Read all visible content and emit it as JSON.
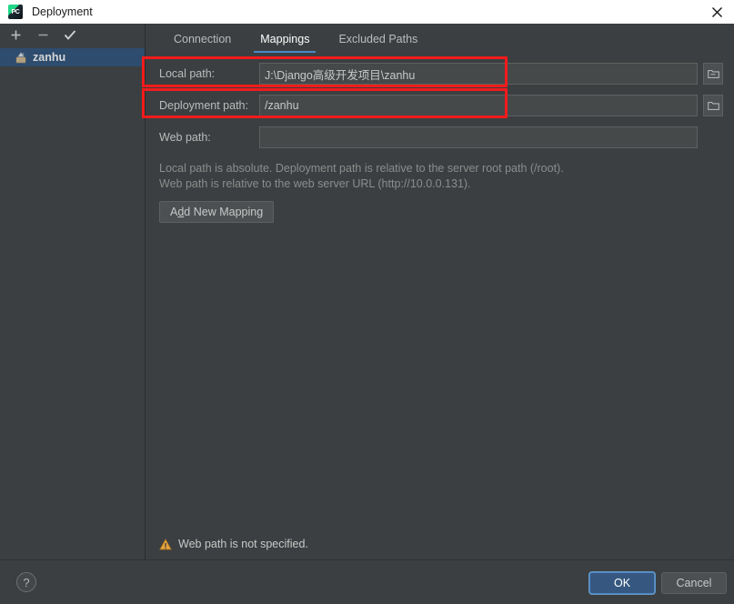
{
  "window": {
    "title": "Deployment",
    "app_icon": "pycharm-icon",
    "app_icon_text": "PC",
    "close_icon": "close-icon"
  },
  "sidebar": {
    "toolbar": [
      {
        "name": "add-server-button",
        "icon": "plus-icon",
        "label": "+"
      },
      {
        "name": "remove-server-button",
        "icon": "minus-icon",
        "label": "−"
      },
      {
        "name": "set-default-server-button",
        "icon": "check-icon",
        "label": "✓"
      }
    ],
    "items": [
      {
        "label": "zanhu",
        "icon": "remote-host-icon",
        "selected": true
      }
    ]
  },
  "main": {
    "tabs": [
      {
        "label": "Connection",
        "active": false
      },
      {
        "label": "Mappings",
        "active": true
      },
      {
        "label": "Excluded Paths",
        "active": false
      }
    ],
    "fields": [
      {
        "label": "Local path:",
        "value": "J:\\Django高级开发项目\\zanhu",
        "placeholder": "",
        "browse_icon": "folder-icon",
        "has_browse": true,
        "highlighted": true
      },
      {
        "label": "Deployment path:",
        "value": "/zanhu",
        "placeholder": "",
        "browse_icon": "folder-icon",
        "has_browse": true,
        "highlighted": true
      },
      {
        "label": "Web path:",
        "value": "",
        "placeholder": "",
        "browse_icon": "folder-icon",
        "has_browse": false,
        "highlighted": false
      }
    ],
    "help_lines": [
      "Local path is absolute. Deployment path is relative to the server root path (/root).",
      "Web path is relative to the web server URL (http://10.0.0.131)."
    ],
    "add_mapping": {
      "prefix": "A",
      "mnemonic": "d",
      "suffix": "d New Mapping",
      "full_label": "Add New Mapping"
    },
    "warning": {
      "icon": "warning-triangle-icon",
      "text": "Web path is not specified."
    }
  },
  "footer": {
    "help_label": "?",
    "help_icon": "question-mark-icon",
    "ok_label": "OK",
    "cancel_label": "Cancel"
  },
  "annotations": [
    {
      "name": "annotation-local-path",
      "color": "#f21b1b"
    },
    {
      "name": "annotation-deployment-path",
      "color": "#f21b1b"
    }
  ],
  "colors": {
    "accent": "#4a88c7",
    "panel_bg": "#3c3f41",
    "selection": "#2d4c6e",
    "annotation": "#f21b1b",
    "warning": "#e8a33d"
  }
}
